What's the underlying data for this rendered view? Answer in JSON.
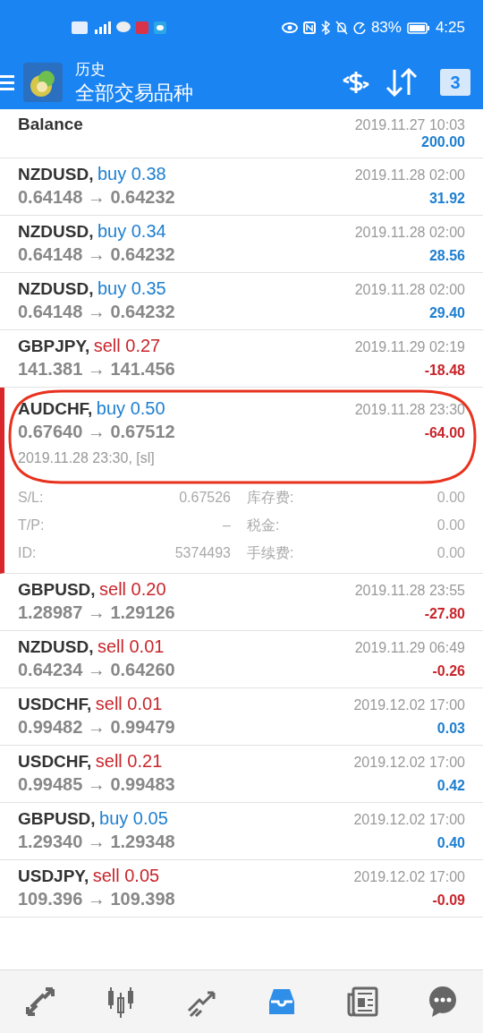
{
  "status_bar": {
    "battery": "83%",
    "time": "4:25"
  },
  "header": {
    "title": "历史",
    "subtitle": "全部交易品种",
    "calendar_day": "3"
  },
  "balance": {
    "label": "Balance",
    "time": "2019.11.27 10:03",
    "amount": "200.00"
  },
  "deals": [
    {
      "symbol": "NZDUSD,",
      "order": "buy 0.38",
      "color": "#1e7fd0",
      "prices": "0.64148 → 0.64232",
      "time": "2019.11.28 02:00",
      "profit": "31.92",
      "loss": false,
      "selected": false
    },
    {
      "symbol": "NZDUSD,",
      "order": "buy 0.34",
      "color": "#1e7fd0",
      "prices": "0.64148 → 0.64232",
      "time": "2019.11.28 02:00",
      "profit": "28.56",
      "loss": false,
      "selected": false
    },
    {
      "symbol": "NZDUSD,",
      "order": "buy 0.35",
      "color": "#1e7fd0",
      "prices": "0.64148 → 0.64232",
      "time": "2019.11.28 02:00",
      "profit": "29.40",
      "loss": false,
      "selected": false
    },
    {
      "symbol": "GBPJPY,",
      "order": "sell 0.27",
      "color": "#c8262c",
      "prices": "141.381 → 141.456",
      "time": "2019.11.29 02:19",
      "profit": "-18.48",
      "loss": true,
      "selected": false
    },
    {
      "symbol": "AUDCHF,",
      "order": "buy 0.50",
      "color": "#1e7fd0",
      "prices": "0.67640 → 0.67512",
      "time": "2019.11.28 23:30",
      "profit": "-64.00",
      "loss": true,
      "selected": true,
      "details": {
        "close": "2019.11.28 23:30, [sl]",
        "fields": [
          {
            "label": "S/L:",
            "value": "0.67526",
            "label2": "库存费:",
            "value2": "0.00"
          },
          {
            "label": "T/P:",
            "value": "–",
            "label2": "税金:",
            "value2": "0.00"
          },
          {
            "label": "ID:",
            "value": "5374493",
            "label2": "手续费:",
            "value2": "0.00"
          }
        ]
      }
    },
    {
      "symbol": "GBPUSD,",
      "order": "sell 0.20",
      "color": "#c8262c",
      "prices": "1.28987 → 1.29126",
      "time": "2019.11.28 23:55",
      "profit": "-27.80",
      "loss": true,
      "selected": false
    },
    {
      "symbol": "NZDUSD,",
      "order": "sell 0.01",
      "color": "#c8262c",
      "prices": "0.64234 → 0.64260",
      "time": "2019.11.29 06:49",
      "profit": "-0.26",
      "loss": true,
      "selected": false
    },
    {
      "symbol": "USDCHF,",
      "order": "sell 0.01",
      "color": "#c8262c",
      "prices": "0.99482 → 0.99479",
      "time": "2019.12.02 17:00",
      "profit": "0.03",
      "loss": false,
      "selected": false
    },
    {
      "symbol": "USDCHF,",
      "order": "sell 0.21",
      "color": "#c8262c",
      "prices": "0.99485 → 0.99483",
      "time": "2019.12.02 17:00",
      "profit": "0.42",
      "loss": false,
      "selected": false
    },
    {
      "symbol": "GBPUSD,",
      "order": "buy 0.05",
      "color": "#1e7fd0",
      "prices": "1.29340 → 1.29348",
      "time": "2019.12.02 17:00",
      "profit": "0.40",
      "loss": false,
      "selected": false
    },
    {
      "symbol": "USDJPY,",
      "order": "sell 0.05",
      "color": "#c8262c",
      "prices": "109.396 → 109.398",
      "time": "2019.12.02 17:00",
      "profit": "-0.09",
      "loss": true,
      "selected": false
    }
  ],
  "nav": [
    {
      "kind": "quotes",
      "selected": false
    },
    {
      "kind": "chart",
      "selected": false
    },
    {
      "kind": "trade",
      "selected": false
    },
    {
      "kind": "history",
      "selected": true
    },
    {
      "kind": "news",
      "selected": false
    },
    {
      "kind": "chat",
      "selected": false
    }
  ]
}
